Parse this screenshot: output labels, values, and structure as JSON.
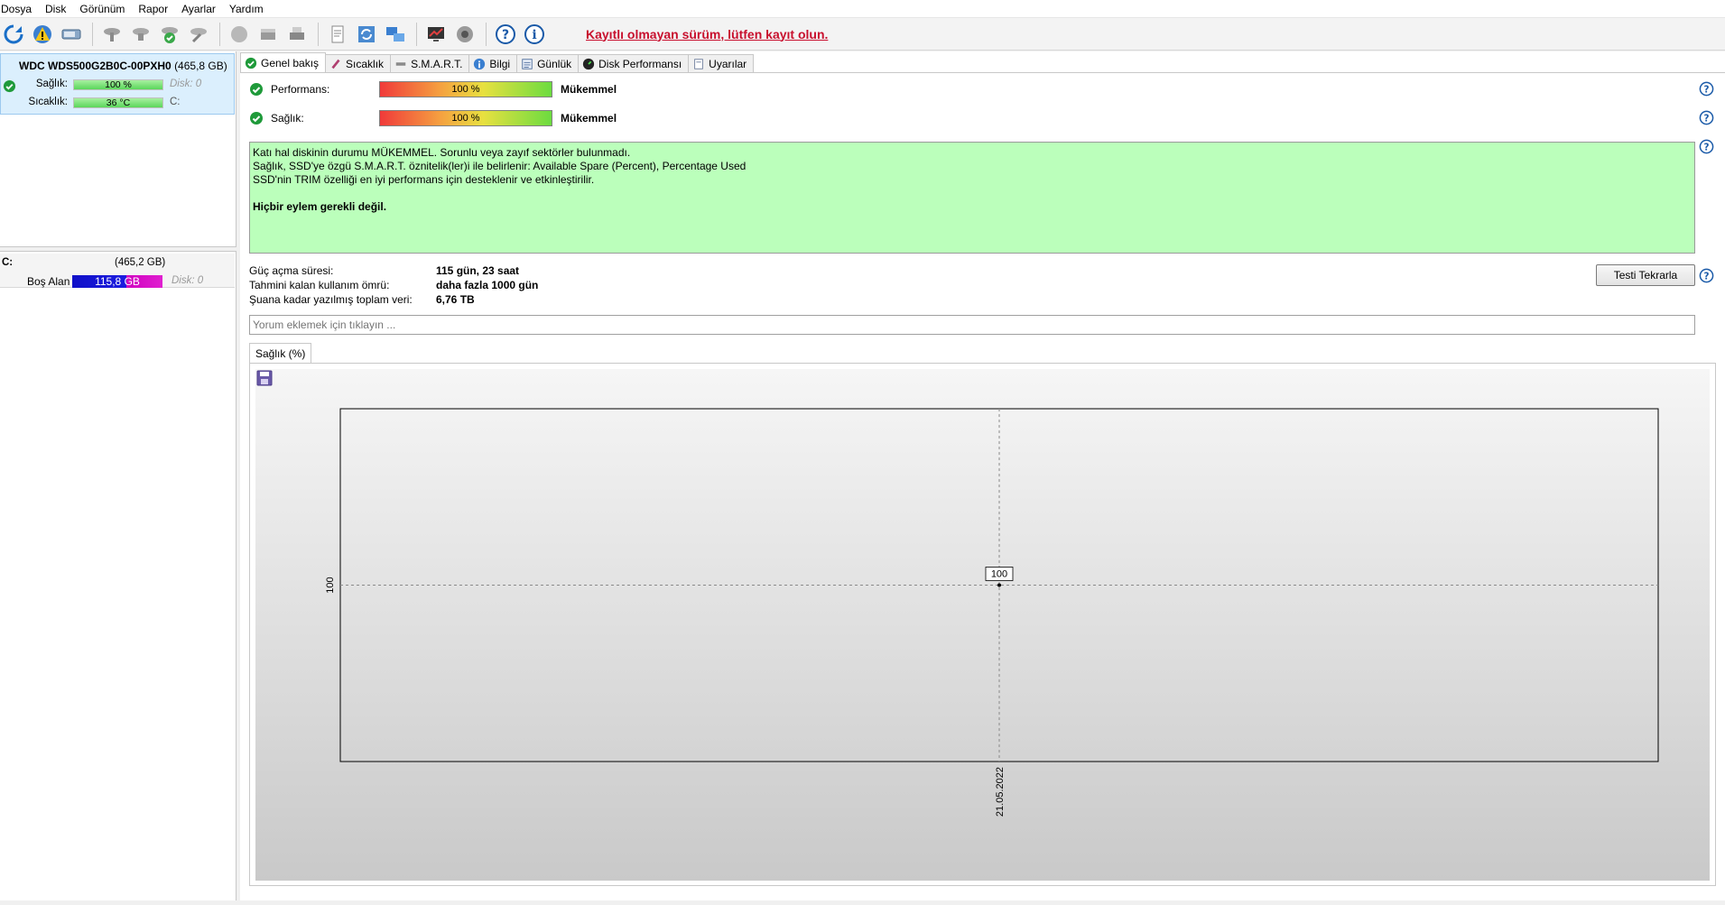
{
  "menu": [
    "Dosya",
    "Disk",
    "Görünüm",
    "Rapor",
    "Ayarlar",
    "Yardım"
  ],
  "toolbar": {
    "register_link": "Kayıtlı olmayan sürüm, lütfen kayıt olun."
  },
  "left": {
    "disk_name": "WDC WDS500G2B0C-00PXH0",
    "disk_size": "(465,8 GB)",
    "health_label": "Sağlık:",
    "health_value": "100 %",
    "disk_index": "Disk: 0",
    "temp_label": "Sıcaklık:",
    "temp_value": "36 °C",
    "drive_letter": "C:",
    "volume_label": "C:",
    "volume_size": "(465,2 GB)",
    "free_label": "Boş Alan",
    "free_value": "115,8 GB",
    "volume_disk": "Disk: 0"
  },
  "tabs": [
    {
      "label": "Genel bakış",
      "icon": "check-circle-icon",
      "active": true
    },
    {
      "label": "Sıcaklık",
      "icon": "thermometer-icon",
      "active": false
    },
    {
      "label": "S.M.A.R.T.",
      "icon": "smart-icon",
      "active": false
    },
    {
      "label": "Bilgi",
      "icon": "info-icon",
      "active": false
    },
    {
      "label": "Günlük",
      "icon": "log-icon",
      "active": false
    },
    {
      "label": "Disk Performansı",
      "icon": "gauge-icon",
      "active": false
    },
    {
      "label": "Uyarılar",
      "icon": "alert-icon",
      "active": false
    }
  ],
  "overview": {
    "performance_label": "Performans:",
    "performance_percent": 100,
    "performance_text": "100 %",
    "performance_status": "Mükemmel",
    "health_label": "Sağlık:",
    "health_percent": 100,
    "health_text": "100 %",
    "health_status": "Mükemmel",
    "message_lines": [
      "Katı hal diskinin durumu MÜKEMMEL. Sorunlu veya zayıf sektörler bulunmadı.",
      "Sağlık, SSD'ye özgü S.M.A.R.T. öznitelik(ler)i ile belirlenir:  Available Spare (Percent), Percentage Used",
      "SSD'nin TRIM özelliği en iyi performans için desteklenir ve etkinleştirilir."
    ],
    "message_bold": "Hiçbir eylem gerekli değil.",
    "power_on_label": "Güç açma süresi:",
    "power_on_value": "115 gün, 23 saat",
    "lifetime_label": "Tahmini kalan kullanım ömrü:",
    "lifetime_value": "daha fazla 1000 gün",
    "written_label": "Şuana kadar yazılmış toplam veri:",
    "written_value": "6,76 TB",
    "retest_button": "Testi Tekrarla",
    "comment_placeholder": "Yorum eklemek için tıklayın ..."
  },
  "chart_tab": "Sağlık (%)",
  "chart_data": {
    "type": "line",
    "title": "",
    "xlabel": "",
    "ylabel": "",
    "x": [
      "21.05.2022"
    ],
    "series": [
      {
        "values": [
          100
        ]
      }
    ],
    "y_ticks": [
      "100"
    ],
    "x_ticks": [
      "21.05.2022"
    ],
    "data_labels": [
      "100"
    ],
    "grid": true
  },
  "colors": {
    "register_link": "#c8102e",
    "info_bg": "#bbffbb",
    "selected_disk_bg": "#dbeffd",
    "ok_green": "#1f9a3a"
  }
}
